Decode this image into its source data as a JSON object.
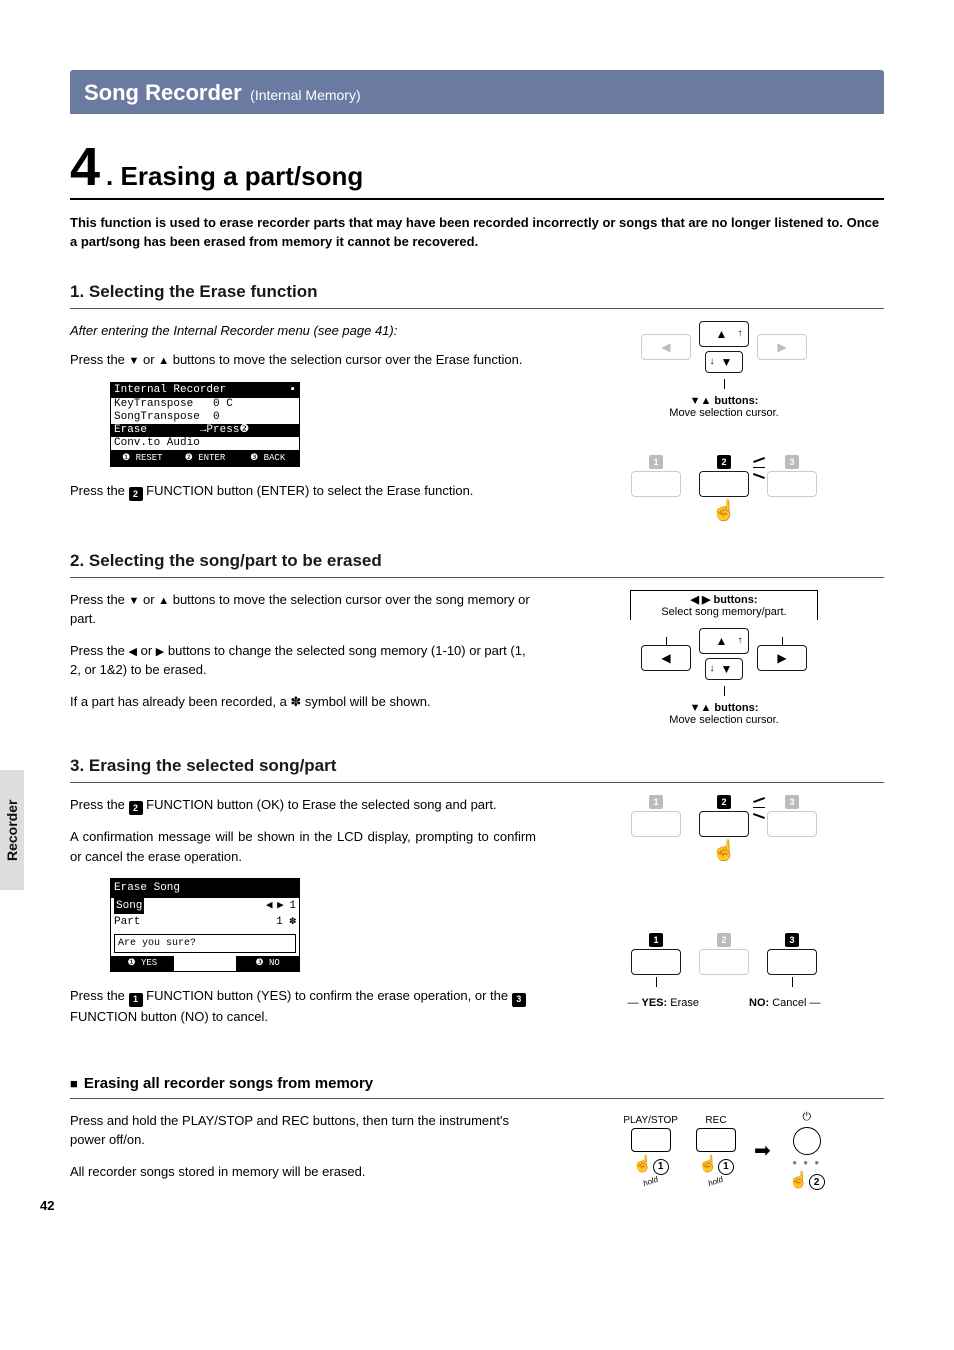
{
  "chapter": {
    "title": "Song Recorder",
    "sub": "(Internal Memory)"
  },
  "main_heading": {
    "num": "4",
    "suffix": ".",
    "text": "Erasing a part/song"
  },
  "intro": "This function is used to erase recorder parts that may have been recorded incorrectly or songs that are no longer listened to.  Once a part/song has been erased from memory it cannot be recovered.",
  "section1": {
    "heading": "1. Selecting the Erase function",
    "note": "After entering the Internal Recorder menu (see page 41):",
    "p1a": "Press the ",
    "p1b": " or ",
    "p1c": " buttons to move the selection cursor over the Erase function.",
    "p2a": "Press the ",
    "p2b": " FUNCTION button (ENTER) to select the Erase function.",
    "lcd": {
      "title": "Internal Recorder",
      "r1": "KeyTranspose   0 C",
      "r2": "SongTranspose  0",
      "r3": "Erase        →Press❷",
      "r4": "Conv.to Audio",
      "f1": "❶ RESET",
      "f2": "❷ ENTER",
      "f3": "❸ BACK"
    },
    "right": {
      "btn_label": "▼▲ buttons:",
      "btn_desc": "Move selection cursor."
    }
  },
  "section2": {
    "heading": "2. Selecting the song/part to be erased",
    "p1a": "Press the ",
    "p1b": " or ",
    "p1c": " buttons to move the selection cursor over the song memory or part.",
    "p2a": "Press the ",
    "p2b": " or ",
    "p2c": " buttons to change the selected song memory (1-10) or part (1, 2, or 1&2) to be erased.",
    "p3": "If a part has already been recorded, a ✽ symbol will be shown.",
    "right": {
      "lr_label": "◀ ▶ buttons:",
      "lr_desc": "Select song memory/part.",
      "ud_label": "▼▲ buttons:",
      "ud_desc": "Move selection cursor."
    }
  },
  "section3": {
    "heading": "3. Erasing the selected song/part",
    "p1a": "Press the ",
    "p1b": " FUNCTION button (OK) to Erase the selected song and part.",
    "p2": "A confirmation message will be shown in the LCD display, prompting to confirm or cancel the erase operation.",
    "p3a": "Press the ",
    "p3b": " FUNCTION button (YES) to confirm the erase operation, or the ",
    "p3c": " FUNCTION button (NO) to cancel.",
    "lcd": {
      "title": "Erase Song",
      "r1l": "Song",
      "r1n": "1",
      "r1arrows": "◀   ▶",
      "r2l": "Part",
      "r2v": "1  ✽",
      "prompt": "Are you sure?",
      "f1": "❶  YES",
      "f3": "❸  NO"
    },
    "right": {
      "yes": "YES:",
      "yes_d": "Erase",
      "no": "NO:",
      "no_d": "Cancel"
    }
  },
  "erase_all": {
    "heading": "Erasing all recorder songs from memory",
    "p1": "Press and hold the PLAY/STOP and REC buttons, then turn the instrument's power off/on.",
    "p2": "All recorder songs stored in memory will be erased.",
    "labels": {
      "play_stop": "PLAY/STOP",
      "rec": "REC",
      "hold": "hold"
    }
  },
  "side_tab": "Recorder",
  "page_number": "42",
  "glyphs": {
    "down": "▼",
    "up": "▲",
    "left": "◀",
    "right": "▶",
    "star": "✽"
  }
}
